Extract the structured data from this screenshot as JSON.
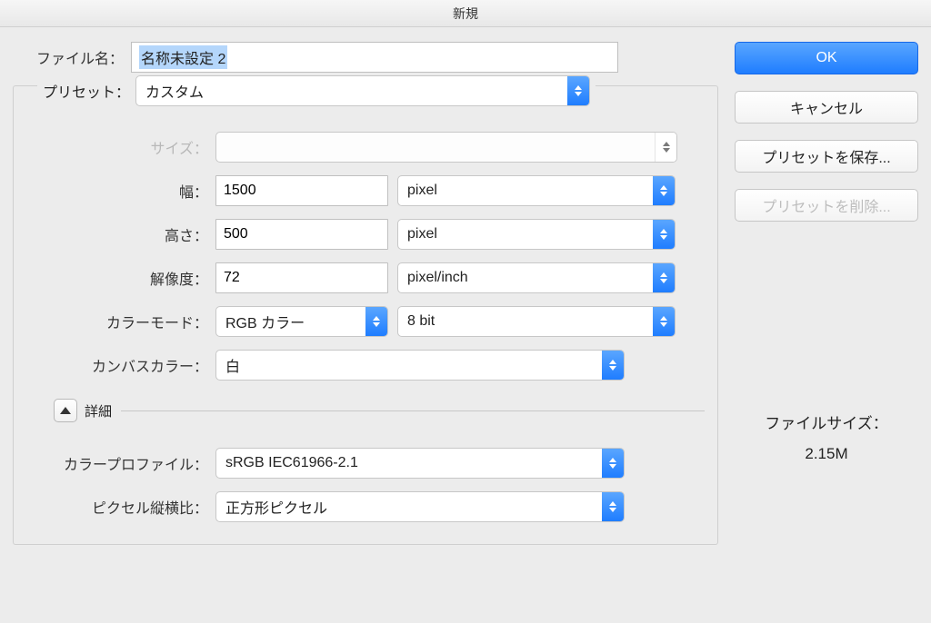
{
  "title": "新規",
  "filename": {
    "label": "ファイル名：",
    "value": "名称未設定 2"
  },
  "preset": {
    "legend": "プリセット：",
    "value": "カスタム"
  },
  "size": {
    "label": "サイズ：",
    "value": ""
  },
  "width": {
    "label": "幅：",
    "value": "1500",
    "unit": "pixel"
  },
  "height": {
    "label": "高さ：",
    "value": "500",
    "unit": "pixel"
  },
  "resolution": {
    "label": "解像度：",
    "value": "72",
    "unit": "pixel/inch"
  },
  "colormode": {
    "label": "カラーモード：",
    "value": "RGB カラー",
    "depth": "8 bit"
  },
  "canvas": {
    "label": "カンバスカラー：",
    "value": "白"
  },
  "detailsLabel": "詳細",
  "profile": {
    "label": "カラープロファイル：",
    "value": "sRGB IEC61966-2.1"
  },
  "aspect": {
    "label": "ピクセル縦横比：",
    "value": "正方形ピクセル"
  },
  "buttons": {
    "ok": "OK",
    "cancel": "キャンセル",
    "savePreset": "プリセットを保存...",
    "deletePreset": "プリセットを削除..."
  },
  "filesize": {
    "label": "ファイルサイズ：",
    "value": "2.15M"
  }
}
